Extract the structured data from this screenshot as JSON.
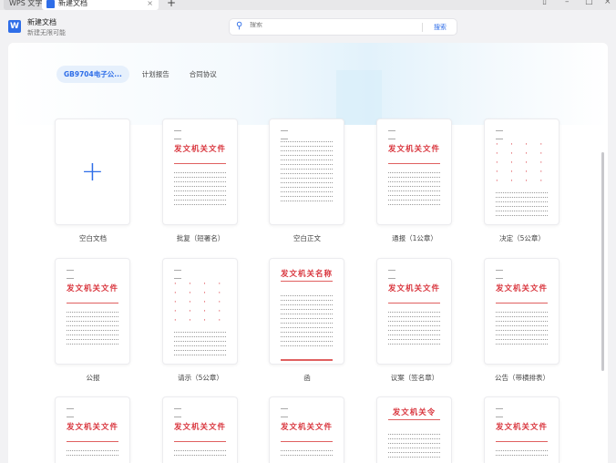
{
  "tabs": [
    {
      "label": "WPS 文字"
    },
    {
      "label": "新建文档"
    }
  ],
  "app": {
    "title": "新建文档",
    "subtitle": "新建无限可能",
    "logo": "W"
  },
  "search": {
    "placeholder": "搜索",
    "button": "搜索"
  },
  "categories": [
    {
      "label": "GB9704电子公...",
      "active": true
    },
    {
      "label": "计划报告"
    },
    {
      "label": "合同协议"
    }
  ],
  "templates": [
    {
      "label": "空白文档",
      "kind": "blank"
    },
    {
      "label": "批复（短署名）",
      "kind": "file",
      "title": "发文机关文件"
    },
    {
      "label": "空白正文",
      "kind": "text"
    },
    {
      "label": "通报（1公章）",
      "kind": "file",
      "title": "发文机关文件"
    },
    {
      "label": "决定（5公章）",
      "kind": "multi"
    },
    {
      "label": "公报",
      "kind": "file",
      "title": "发文机关文件"
    },
    {
      "label": "请示（5公章）",
      "kind": "multi"
    },
    {
      "label": "函",
      "kind": "letter",
      "title": "发文机关名称"
    },
    {
      "label": "议案（签名章）",
      "kind": "file",
      "title": "发文机关文件"
    },
    {
      "label": "公告（带横排表）",
      "kind": "file",
      "title": "发文机关文件"
    },
    {
      "label": "",
      "kind": "file",
      "title": "发文机关文件"
    },
    {
      "label": "",
      "kind": "file",
      "title": "发文机关文件"
    },
    {
      "label": "",
      "kind": "file",
      "title": "发文机关文件"
    },
    {
      "label": "",
      "kind": "letter",
      "title": "发文机关令"
    },
    {
      "label": "",
      "kind": "file",
      "title": "发文机关文件"
    }
  ],
  "colors": {
    "accent": "#2f6ee8",
    "red": "#d9363e"
  }
}
